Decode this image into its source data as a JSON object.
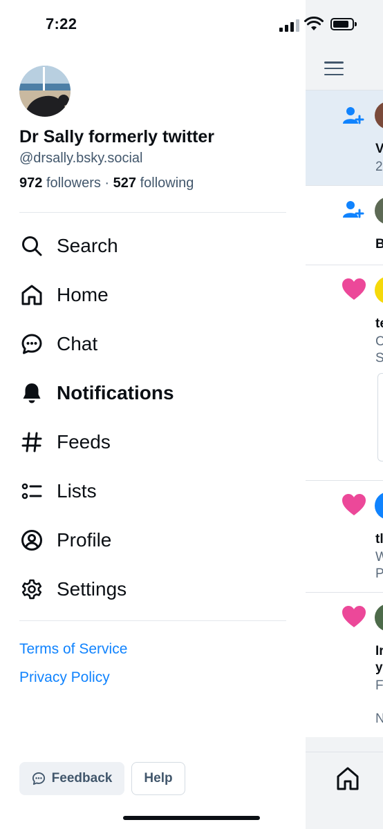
{
  "status_bar": {
    "time": "7:22"
  },
  "profile": {
    "display_name": "Dr Sally formerly twitter",
    "handle": "@drsally.bsky.social",
    "followers_count": "972",
    "followers_label": "followers",
    "separator": "·",
    "following_count": "527",
    "following_label": "following"
  },
  "nav": {
    "items": [
      {
        "label": "Search",
        "icon": "search-icon"
      },
      {
        "label": "Home",
        "icon": "home-icon"
      },
      {
        "label": "Chat",
        "icon": "chat-icon"
      },
      {
        "label": "Notifications",
        "icon": "bell-icon",
        "active": true
      },
      {
        "label": "Feeds",
        "icon": "hash-icon"
      },
      {
        "label": "Lists",
        "icon": "list-icon"
      },
      {
        "label": "Profile",
        "icon": "user-circle-icon"
      },
      {
        "label": "Settings",
        "icon": "gear-icon"
      }
    ]
  },
  "links": {
    "terms": "Terms of Service",
    "privacy": "Privacy Policy"
  },
  "buttons": {
    "feedback": "Feedback",
    "help": "Help"
  },
  "background": {
    "notif_1_line_1": "V",
    "notif_1_line_2": "2",
    "notif_2_line_1": "B",
    "notif_3_line_1": "te",
    "notif_3_line_2": "C",
    "notif_3_line_3": "S",
    "notif_4_line_1": "tl",
    "notif_4_line_2": "W",
    "notif_4_line_3": "P",
    "notif_5_line_1": "Ir",
    "notif_5_line_2": "y",
    "notif_5_line_3": "F",
    "notif_5_line_4": "N"
  },
  "colors": {
    "accent": "#1083fe",
    "like": "#ec4899",
    "text": "#0b0f14",
    "muted": "#42576c"
  }
}
